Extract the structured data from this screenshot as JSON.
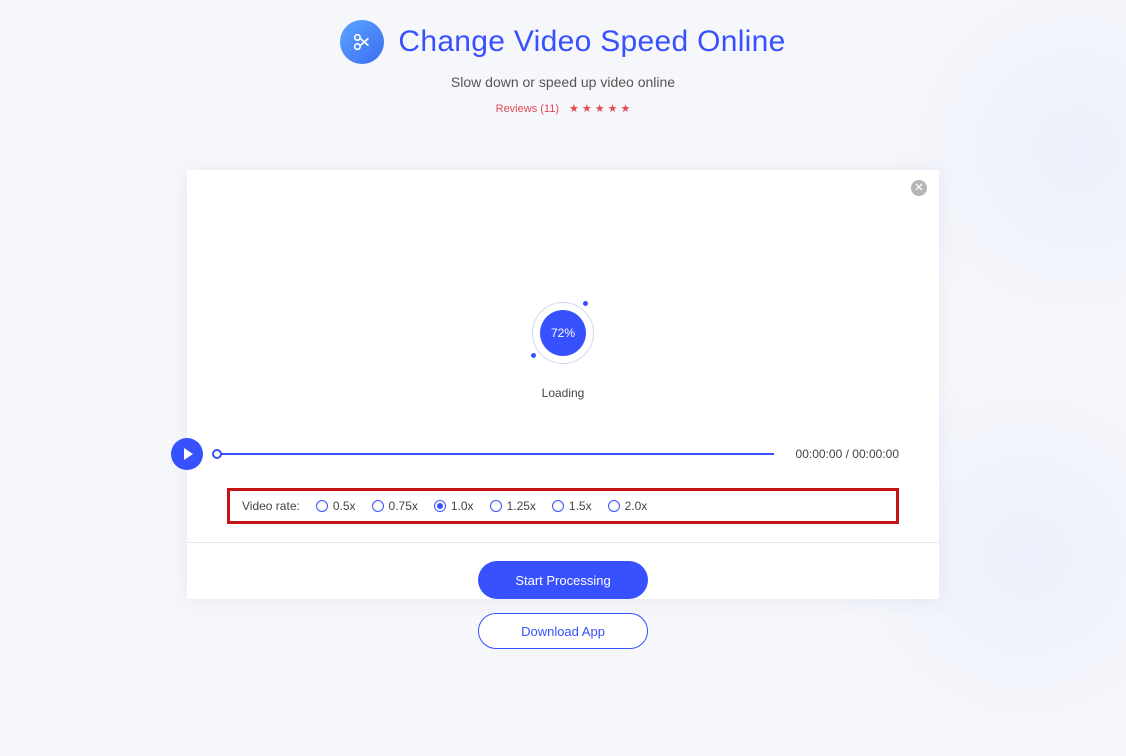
{
  "header": {
    "title": "Change Video Speed Online",
    "subtitle": "Slow down or speed up video online",
    "reviews_label": "Reviews (11)",
    "star_count": 5
  },
  "panel": {
    "progress_percent": "72%",
    "loading_label": "Loading",
    "time_current": "00:00:00",
    "time_separator": " / ",
    "time_total": "00:00:00",
    "rate_label": "Video rate:",
    "rate_options": [
      "0.5x",
      "0.75x",
      "1.0x",
      "1.25x",
      "1.5x",
      "2.0x"
    ],
    "rate_selected_index": 2,
    "process_label": "Start Processing",
    "download_label": "Download App"
  }
}
